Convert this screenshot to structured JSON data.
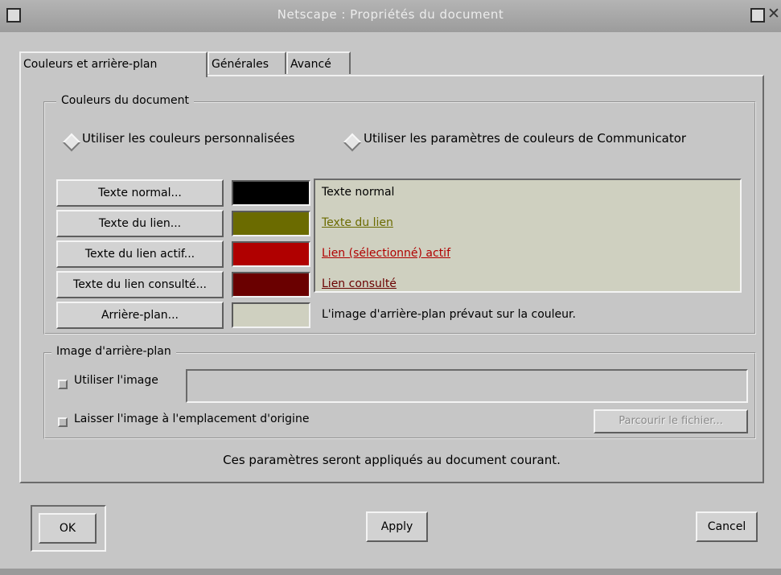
{
  "window": {
    "title": "Netscape : Propriétés du document"
  },
  "tabs": [
    {
      "label": "Couleurs et arrière-plan",
      "active": true
    },
    {
      "label": "Générales",
      "active": false
    },
    {
      "label": "Avancé",
      "active": false
    }
  ],
  "colors_group": {
    "label": "Couleurs du document",
    "radio_custom": "Utiliser les couleurs personnalisées",
    "radio_communicator": "Utiliser les paramètres de couleurs de Communicator",
    "selected": "custom",
    "rows": [
      {
        "button": "Texte normal...",
        "color": "#000000",
        "preview": "Texte normal",
        "preview_color": "#000000",
        "underline": false
      },
      {
        "button": "Texte du lien...",
        "color": "#6b6b00",
        "preview": "Texte du lien",
        "preview_color": "#6b6b00",
        "underline": true
      },
      {
        "button": "Texte du lien actif...",
        "color": "#b00000",
        "preview": "Lien (sélectionné) actif",
        "preview_color": "#b00000",
        "underline": true
      },
      {
        "button": "Texte du lien consulté...",
        "color": "#6a0000",
        "preview": "Lien consulté",
        "preview_color": "#6a0000",
        "underline": true
      },
      {
        "button": "Arrière-plan...",
        "color": "#cfd0c0",
        "preview": "L'image d'arrière-plan prévaut sur la couleur.",
        "preview_color": "#000000",
        "underline": false
      }
    ]
  },
  "image_group": {
    "label": "Image d'arrière-plan",
    "use_image_label": "Utiliser l'image",
    "use_image_checked": false,
    "image_path_value": "",
    "keep_origin_label": "Laisser l'image à l'emplacement d'origine",
    "keep_origin_checked": false,
    "browse_label": "Parcourir le fichier..."
  },
  "note": "Ces paramètres seront appliqués au document courant.",
  "footer": {
    "ok": "OK",
    "apply": "Apply",
    "cancel": "Cancel"
  }
}
